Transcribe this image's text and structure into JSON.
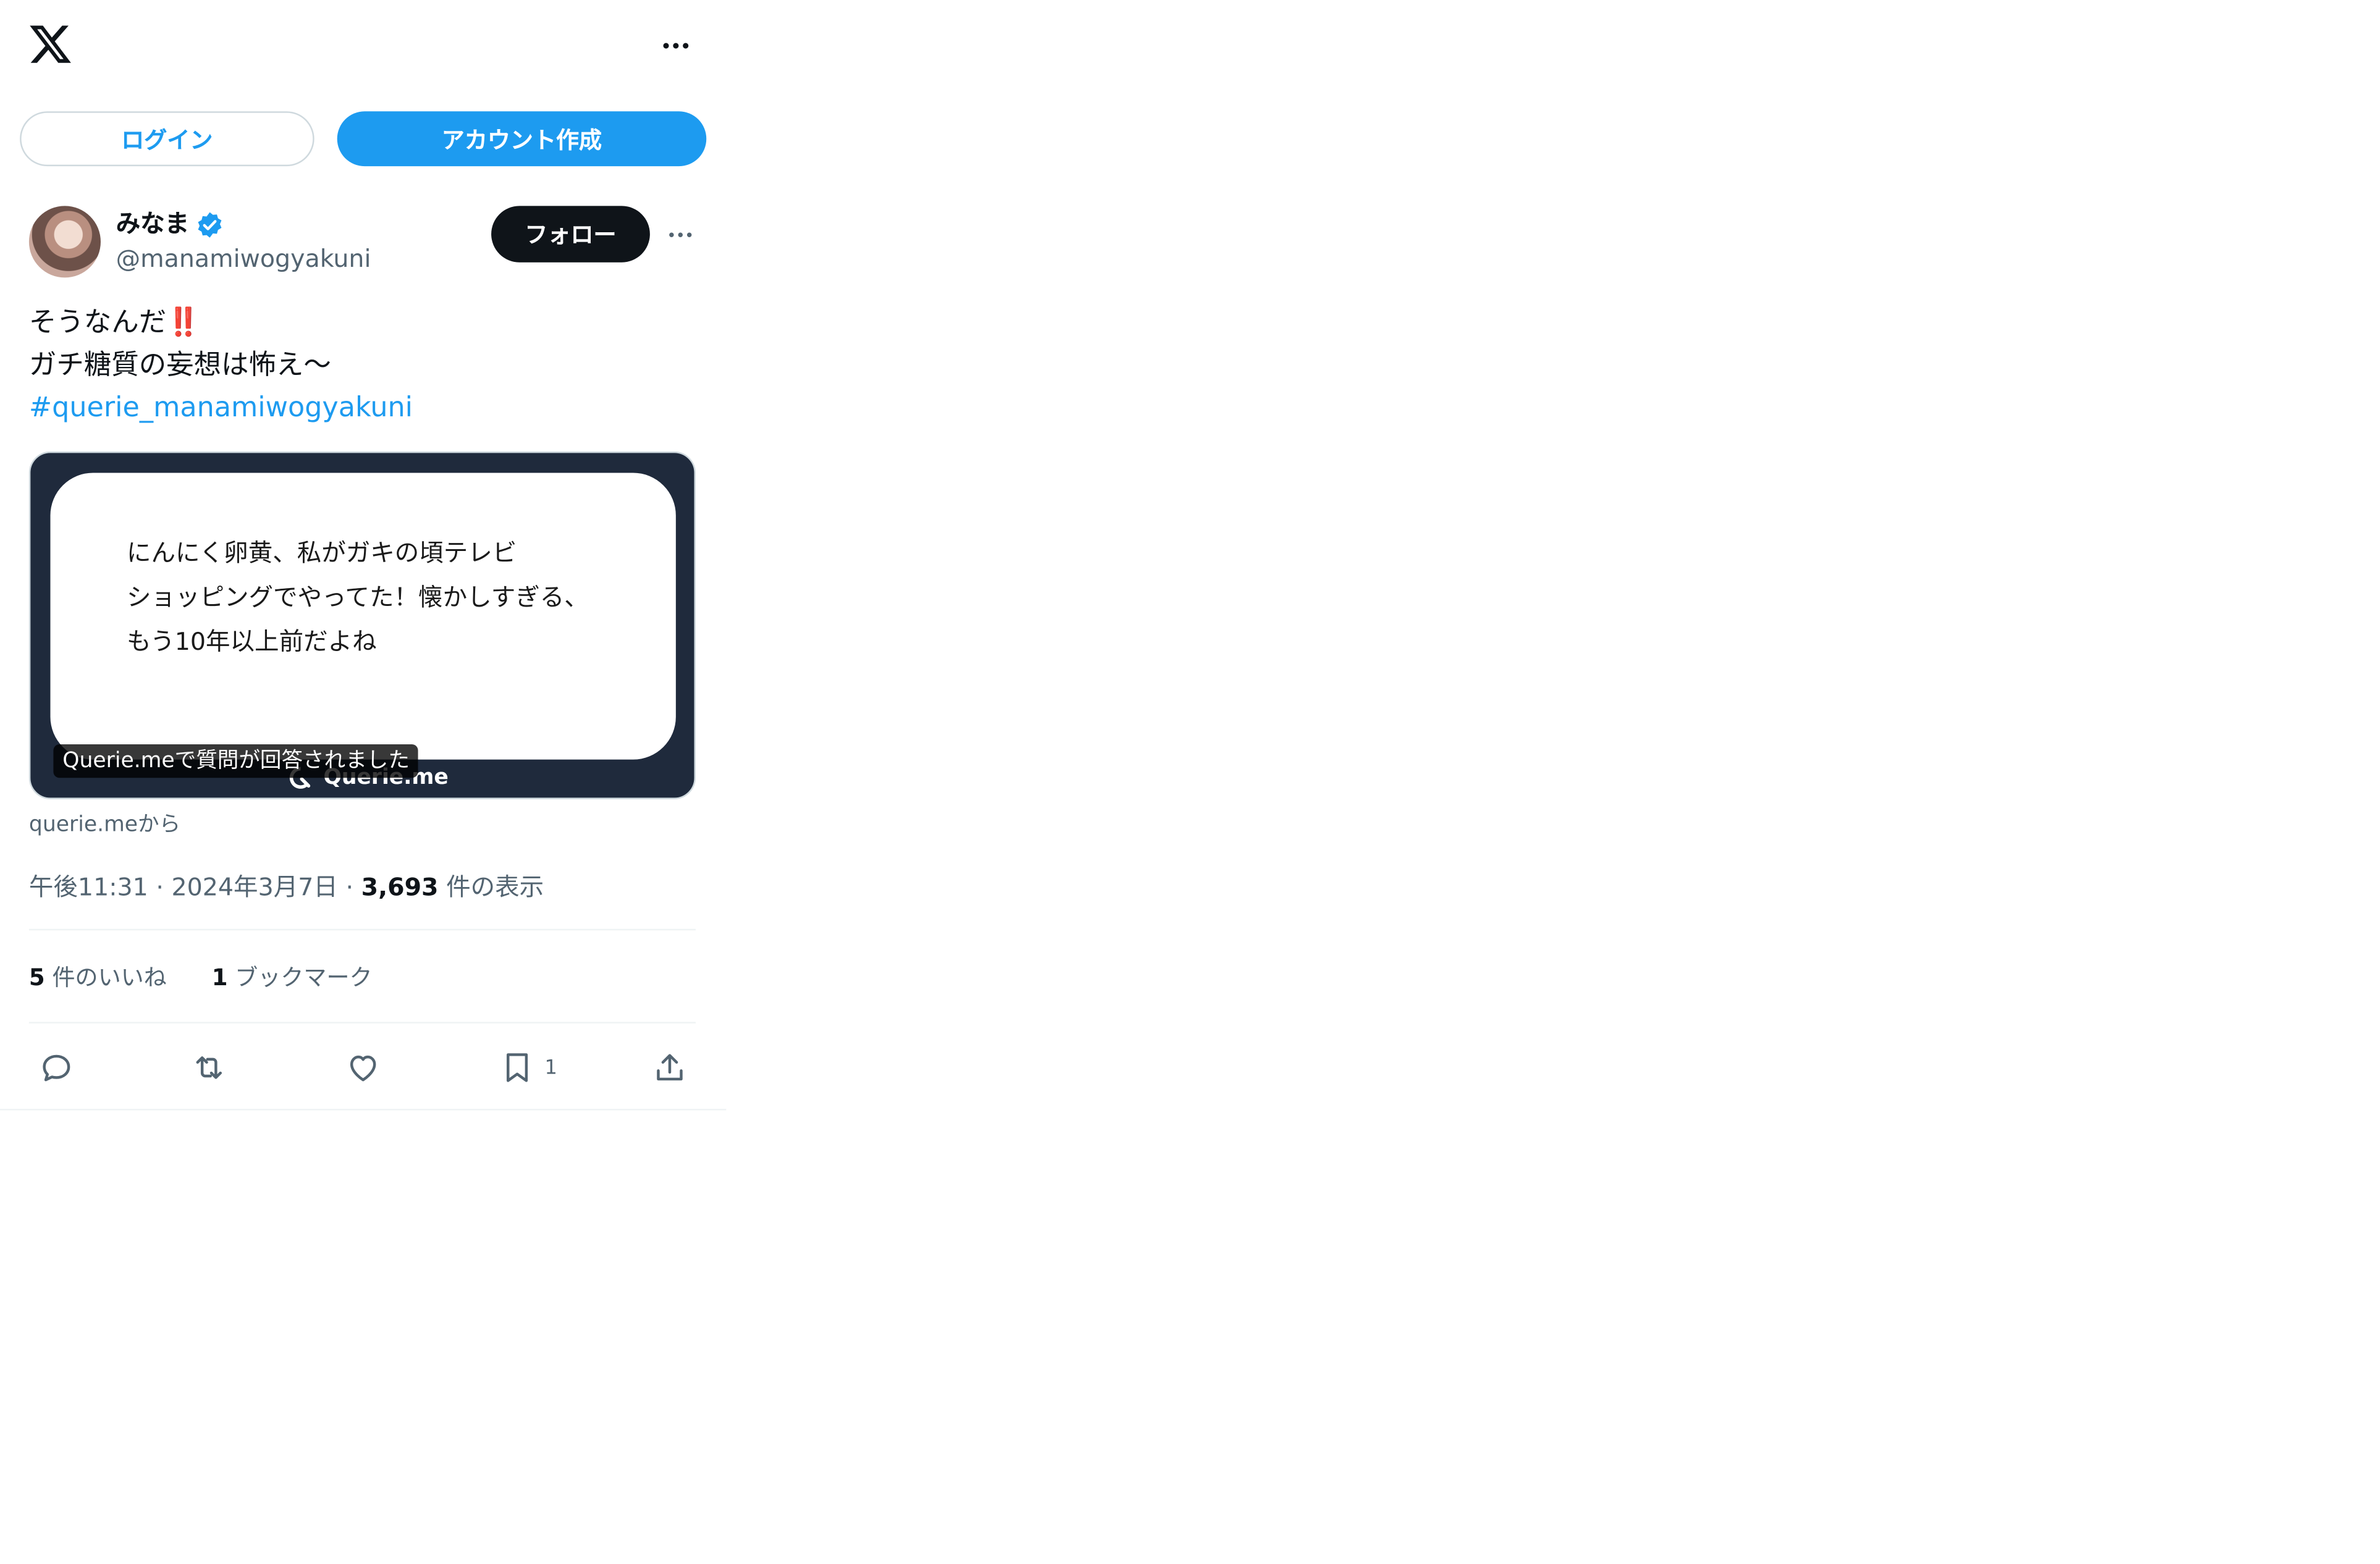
{
  "header": {
    "logo": "x-logo-icon",
    "more_icon": "more-horizontal-icon"
  },
  "auth": {
    "login_label": "ログイン",
    "signup_label": "アカウント作成"
  },
  "author": {
    "display_name": "みなま",
    "verified": true,
    "handle": "@manamiwogyakuni",
    "follow_label": "フォロー"
  },
  "tweet": {
    "line1": "そうなんだ",
    "line1_emoji": "‼️",
    "line2": "ガチ糖質の妄想は怖え〜",
    "hashtag": "#querie_manamiwogyakuni"
  },
  "card": {
    "question_lines": [
      "にんにく卵黄、私がガキの頃テレビ",
      "ショッピングでやってた！懐かしすぎる、",
      "もう10年以上前だよね"
    ],
    "brand": "Querie.me",
    "caption": "Querie.meで質問が回答されました",
    "source": "querie.meから"
  },
  "meta": {
    "time": "午後11:31",
    "date": "2024年3月7日",
    "views_count": "3,693",
    "views_label": "件の表示"
  },
  "stats": {
    "likes_count": "5",
    "likes_label": "件のいいね",
    "bookmarks_count": "1",
    "bookmarks_label": "ブックマーク"
  },
  "actions": {
    "bookmark_count": "1"
  },
  "colors": {
    "accent": "#1d9bf0",
    "text": "#0f1419",
    "muted": "#536471",
    "card_bg": "#1f2a3c"
  }
}
